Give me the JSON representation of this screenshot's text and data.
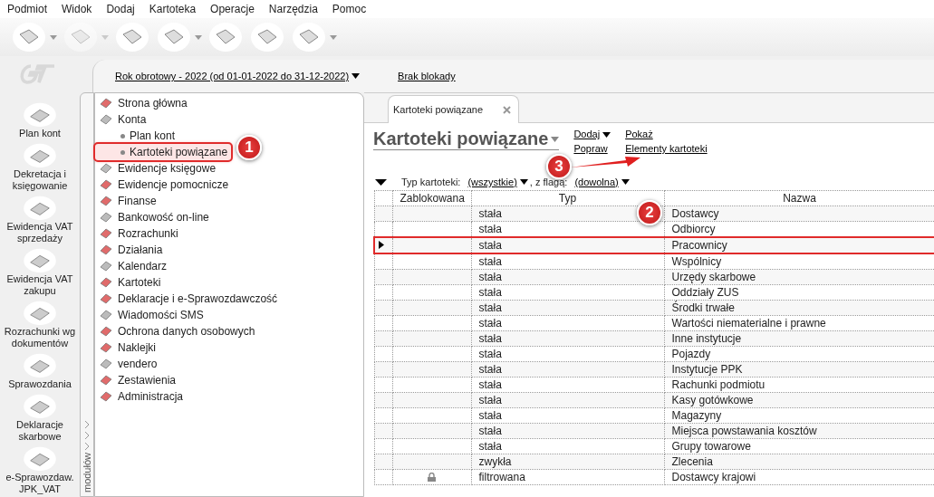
{
  "menu": [
    "Podmiot",
    "Widok",
    "Dodaj",
    "Kartoteka",
    "Operacje",
    "Narzędzia",
    "Pomoc"
  ],
  "toolbar": [
    {
      "dropdown": true,
      "disabled": false
    },
    {
      "dropdown": true,
      "disabled": true
    },
    {
      "dropdown": false,
      "disabled": false
    },
    {
      "dropdown": true,
      "disabled": false
    },
    {
      "dropdown": false,
      "disabled": false
    },
    {
      "dropdown": false,
      "disabled": false
    },
    {
      "dropdown": true,
      "disabled": false
    }
  ],
  "period": {
    "label": "Rok obrotowy - 2022  (od 01-01-2022 do 31-12-2022)",
    "lock": "Brak blokady"
  },
  "modules": [
    {
      "label": "Plan kont"
    },
    {
      "label": "Dekretacja i księgowanie"
    },
    {
      "label": "Ewidencja VAT sprzedaży"
    },
    {
      "label": "Ewidencja VAT zakupu"
    },
    {
      "label": "Rozrachunki wg dokumentów"
    },
    {
      "label": "Sprawozdania"
    },
    {
      "label": "Deklaracje skarbowe"
    },
    {
      "label": "e-Sprawozdaw. JPK_VAT"
    }
  ],
  "modules_strip": "modułów",
  "tree": [
    {
      "label": "Strona główna",
      "selected": false
    },
    {
      "label": "Konta",
      "selected": false,
      "children": [
        {
          "label": "Plan kont",
          "selected": false
        },
        {
          "label": "Kartoteki powiązane",
          "selected": true
        }
      ]
    },
    {
      "label": "Ewidencje księgowe",
      "selected": false
    },
    {
      "label": "Ewidencje pomocnicze",
      "selected": false
    },
    {
      "label": "Finanse",
      "selected": false
    },
    {
      "label": "Bankowość on-line",
      "selected": false
    },
    {
      "label": "Rozrachunki",
      "selected": false
    },
    {
      "label": "Działania",
      "selected": false
    },
    {
      "label": "Kalendarz",
      "selected": false
    },
    {
      "label": "Kartoteki",
      "selected": false
    },
    {
      "label": "Deklaracje i e-Sprawozdawczość",
      "selected": false
    },
    {
      "label": "Wiadomości SMS",
      "selected": false
    },
    {
      "label": "Ochrona danych osobowych",
      "selected": false
    },
    {
      "label": "Naklejki",
      "selected": false
    },
    {
      "label": "vendero",
      "selected": false
    },
    {
      "label": "Zestawienia",
      "selected": false
    },
    {
      "label": "Administracja",
      "selected": false
    }
  ],
  "tab": {
    "label": "Kartoteki powiązane"
  },
  "title": "Kartoteki powiązane",
  "actions": [
    [
      "Dodaj",
      "Popraw"
    ],
    [
      "Pokaż",
      "Elementy kartoteki"
    ]
  ],
  "filter": {
    "label": "Typ kartoteki:",
    "type": "(wszystkie)",
    "sep": ", z flagą:",
    "flag": "(dowolna)"
  },
  "table": {
    "columns": [
      "Zablokowana",
      "Typ",
      "Nazwa"
    ],
    "rows": [
      {
        "locked": false,
        "selected": false,
        "type": "stała",
        "name": "Dostawcy"
      },
      {
        "locked": false,
        "selected": false,
        "type": "stała",
        "name": "Odbiorcy"
      },
      {
        "locked": false,
        "selected": true,
        "type": "stała",
        "name": "Pracownicy"
      },
      {
        "locked": false,
        "selected": false,
        "type": "stała",
        "name": "Wspólnicy"
      },
      {
        "locked": false,
        "selected": false,
        "type": "stała",
        "name": "Urzędy skarbowe"
      },
      {
        "locked": false,
        "selected": false,
        "type": "stała",
        "name": "Oddziały ZUS"
      },
      {
        "locked": false,
        "selected": false,
        "type": "stała",
        "name": "Środki trwałe"
      },
      {
        "locked": false,
        "selected": false,
        "type": "stała",
        "name": "Wartości niematerialne i prawne"
      },
      {
        "locked": false,
        "selected": false,
        "type": "stała",
        "name": "Inne instytucje"
      },
      {
        "locked": false,
        "selected": false,
        "type": "stała",
        "name": "Pojazdy"
      },
      {
        "locked": false,
        "selected": false,
        "type": "stała",
        "name": "Instytucje PPK"
      },
      {
        "locked": false,
        "selected": false,
        "type": "stała",
        "name": "Rachunki podmiotu"
      },
      {
        "locked": false,
        "selected": false,
        "type": "stała",
        "name": "Kasy gotówkowe"
      },
      {
        "locked": false,
        "selected": false,
        "type": "stała",
        "name": "Magazyny"
      },
      {
        "locked": false,
        "selected": false,
        "type": "stała",
        "name": "Miejsca powstawania kosztów"
      },
      {
        "locked": false,
        "selected": false,
        "type": "stała",
        "name": "Grupy towarowe"
      },
      {
        "locked": false,
        "selected": false,
        "type": "zwykła",
        "name": "Zlecenia"
      },
      {
        "locked": true,
        "selected": false,
        "type": "filtrowana",
        "name": "Dostawcy krajowi"
      }
    ]
  },
  "callouts": [
    "1",
    "2",
    "3"
  ]
}
